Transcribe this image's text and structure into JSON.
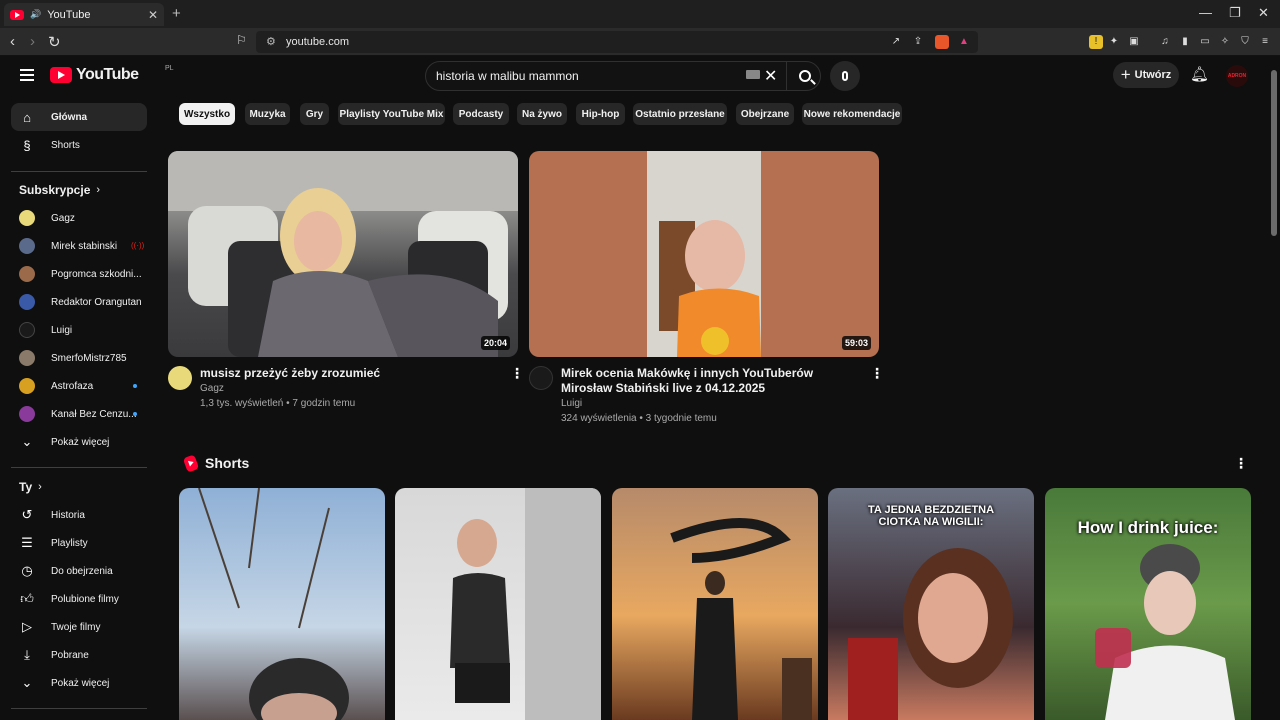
{
  "browser": {
    "tab_title": "YouTube",
    "url": "youtube.com"
  },
  "header": {
    "logo_text": "YouTube",
    "country_code": "PL",
    "search_value": "historia w malibu mammon",
    "create_label": "Utwórz",
    "avatar_text": "ADRON"
  },
  "sidebar": {
    "main": [
      {
        "label": "Główna",
        "icon": "home-icon",
        "active": true
      },
      {
        "label": "Shorts",
        "icon": "shorts-icon",
        "active": false
      }
    ],
    "subscriptions_heading": "Subskrypcje",
    "subscriptions": [
      {
        "label": "Gagz",
        "color": "#e8d97a"
      },
      {
        "label": "Mirek stabinski",
        "color": "#5a6a8a",
        "live": true
      },
      {
        "label": "Pogromca szkodni...",
        "color": "#9a6a4a"
      },
      {
        "label": "Redaktor Orangutan",
        "color": "#3a5aa8"
      },
      {
        "label": "Luigi",
        "color": "#1a1a1a"
      },
      {
        "label": "SmerfoMistrz785",
        "color": "#8a7a6a"
      },
      {
        "label": "Astrofaza",
        "color": "#d8a020",
        "new": true
      },
      {
        "label": "Kanał Bez Cenzu...",
        "color": "#8a3a9a",
        "new": true
      }
    ],
    "show_more": "Pokaż więcej",
    "you_heading": "Ty",
    "you_items": [
      {
        "label": "Historia",
        "icon": "history-icon"
      },
      {
        "label": "Playlisty",
        "icon": "playlist-icon"
      },
      {
        "label": "Do obejrzenia",
        "icon": "watch-later-icon"
      },
      {
        "label": "Polubione filmy",
        "icon": "like-icon"
      },
      {
        "label": "Twoje filmy",
        "icon": "your-videos-icon"
      },
      {
        "label": "Pobrane",
        "icon": "download-icon"
      }
    ],
    "show_more_2": "Pokaż więcej"
  },
  "chips": [
    "Wszystko",
    "Muzyka",
    "Gry",
    "Playlisty YouTube Mix",
    "Podcasty",
    "Na żywo",
    "Hip-hop",
    "Ostatnio przesłane",
    "Obejrzane",
    "Nowe rekomendacje"
  ],
  "videos": [
    {
      "title": "musisz przeżyć żeby zrozumieć",
      "channel": "Gagz",
      "meta": "1,3 tys. wyświetleń • 7 godzin temu",
      "duration": "20:04"
    },
    {
      "title": "Mirek ocenia Makówkę i innych YouTuberów Mirosław Stabiński live z 04.12.2025",
      "channel": "Luigi",
      "meta": "324 wyświetlenia • 3 tygodnie temu",
      "duration": "59:03"
    }
  ],
  "shorts": {
    "heading": "Shorts",
    "items": [
      {
        "overlay": ""
      },
      {
        "overlay": ""
      },
      {
        "overlay": ""
      },
      {
        "overlay": "TA JEDNA BEZDZIETNA CIOTKA NA WIGILII:"
      },
      {
        "overlay": "How I drink juice:"
      }
    ]
  }
}
